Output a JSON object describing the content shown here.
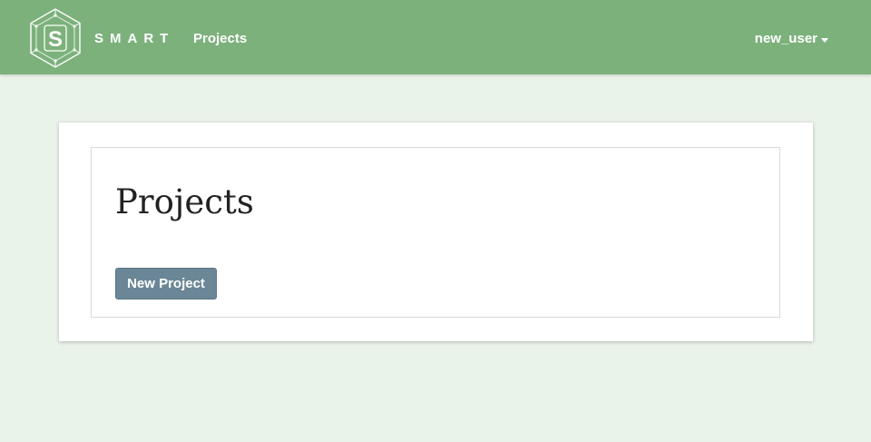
{
  "navbar": {
    "logo_icon": "smart-hexagon-logo-icon",
    "logo_letter": "S",
    "brand": "SMART",
    "projects_link": "Projects",
    "user_menu": {
      "label": "new_user",
      "icon": "caret-down-icon"
    }
  },
  "main": {
    "title": "Projects",
    "new_project_button": "New Project"
  },
  "colors": {
    "navbar_bg": "#7cb17c",
    "page_bg": "#eaf3ea",
    "button_bg": "#6b8797"
  }
}
